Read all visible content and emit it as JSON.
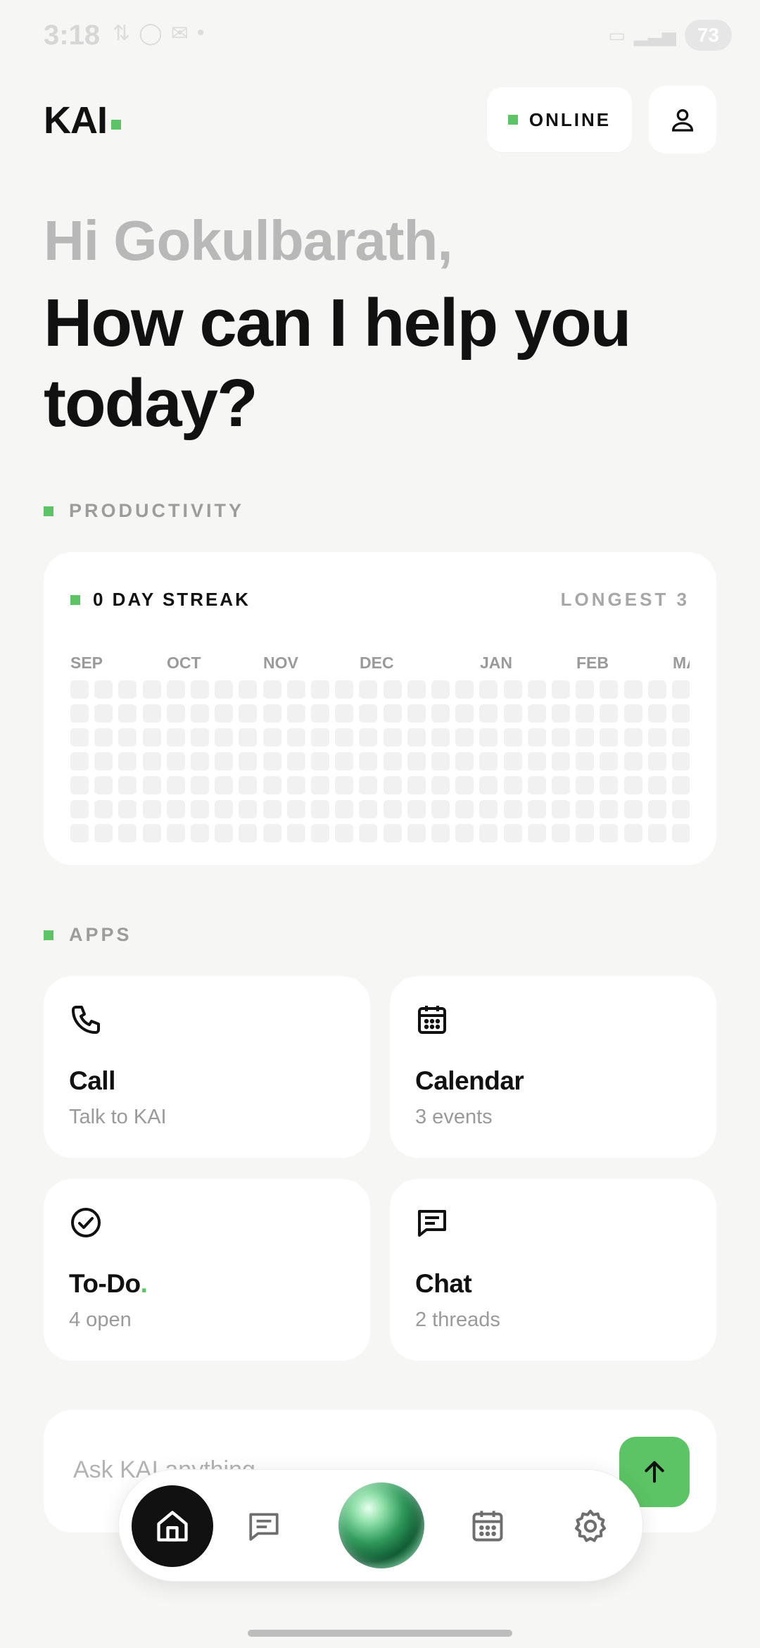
{
  "status": {
    "time": "3:18",
    "battery": "73"
  },
  "header": {
    "logo": "KAI",
    "online_label": "ONLINE"
  },
  "greeting": {
    "hi": "Hi Gokulbarath,",
    "question": "How can I help you today?"
  },
  "productivity": {
    "section_label": "PRODUCTIVITY",
    "streak_label": "0 DAY STREAK",
    "longest_label": "LONGEST 3",
    "months": [
      "SEP",
      "OCT",
      "NOV",
      "DEC",
      "JAN",
      "FEB",
      "MA"
    ]
  },
  "apps": {
    "section_label": "APPS",
    "items": [
      {
        "title": "Call",
        "subtitle": "Talk to KAI",
        "icon": "phone-icon"
      },
      {
        "title": "Calendar",
        "subtitle": "3 events",
        "icon": "calendar-icon"
      },
      {
        "title": "To-Do",
        "subtitle": "4 open",
        "icon": "check-circle-icon"
      },
      {
        "title": "Chat",
        "subtitle": "2 threads",
        "icon": "chat-icon"
      }
    ]
  },
  "input": {
    "placeholder": "Ask KAI anything"
  },
  "nav": {
    "items": [
      "home-icon",
      "chat-icon",
      "kai-orb",
      "calendar-icon",
      "gear-icon"
    ]
  },
  "colors": {
    "accent": "#5cc464",
    "background": "#f6f6f4",
    "card": "#ffffff"
  }
}
